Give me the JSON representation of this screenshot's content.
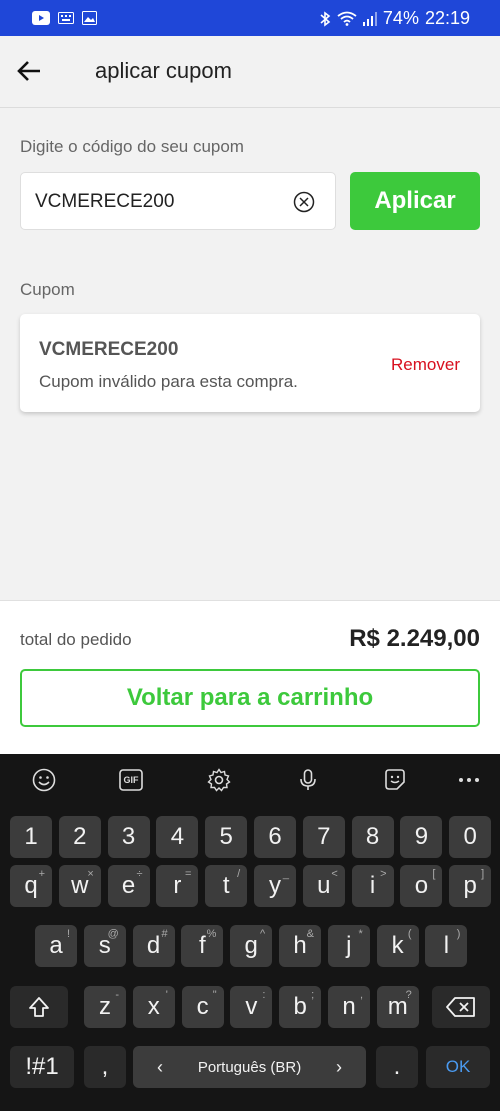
{
  "status_bar": {
    "battery": "74%",
    "time": "22:19"
  },
  "header": {
    "title": "aplicar cupom"
  },
  "coupon_entry": {
    "label": "Digite o código do seu cupom",
    "input_value": "VCMERECE200",
    "apply_label": "Aplicar"
  },
  "coupon_section": {
    "label": "Cupom",
    "code": "VCMERECE200",
    "message": "Cupom inválido para esta compra.",
    "remove_label": "Remover"
  },
  "footer": {
    "total_label": "total do pedido",
    "total_value": "R$ 2.249,00",
    "back_button_label": "Voltar para a carrinho"
  },
  "keyboard": {
    "toolbar": [
      "emoji-icon",
      "gif-icon",
      "settings-icon",
      "microphone-icon",
      "sticker-icon",
      "more-icon"
    ],
    "gif_label": "GIF",
    "row_numbers": [
      "1",
      "2",
      "3",
      "4",
      "5",
      "6",
      "7",
      "8",
      "9",
      "0"
    ],
    "row1": [
      {
        "k": "q",
        "h": "+"
      },
      {
        "k": "w",
        "h": "×"
      },
      {
        "k": "e",
        "h": "÷"
      },
      {
        "k": "r",
        "h": "="
      },
      {
        "k": "t",
        "h": "/"
      },
      {
        "k": "y",
        "h": "_"
      },
      {
        "k": "u",
        "h": "<"
      },
      {
        "k": "i",
        "h": ">"
      },
      {
        "k": "o",
        "h": "["
      },
      {
        "k": "p",
        "h": "]"
      }
    ],
    "row2": [
      {
        "k": "a",
        "h": "!"
      },
      {
        "k": "s",
        "h": "@"
      },
      {
        "k": "d",
        "h": "#"
      },
      {
        "k": "f",
        "h": "%"
      },
      {
        "k": "g",
        "h": "^"
      },
      {
        "k": "h",
        "h": "&"
      },
      {
        "k": "j",
        "h": "*"
      },
      {
        "k": "k",
        "h": "("
      },
      {
        "k": "l",
        "h": ")"
      }
    ],
    "row3": [
      {
        "k": "z",
        "h": "-"
      },
      {
        "k": "x",
        "h": "'"
      },
      {
        "k": "c",
        "h": "\""
      },
      {
        "k": "v",
        "h": ":"
      },
      {
        "k": "b",
        "h": ";"
      },
      {
        "k": "n",
        "h": ","
      },
      {
        "k": "m",
        "h": "?"
      }
    ],
    "symbols_key": "!#1",
    "comma_key": ",",
    "space_label": "Português (BR)",
    "period_key": ".",
    "ok_key": "OK"
  },
  "colors": {
    "status_bar": "#1f47d8",
    "accent_green": "#3dc93c",
    "remove_red": "#d8101f"
  }
}
